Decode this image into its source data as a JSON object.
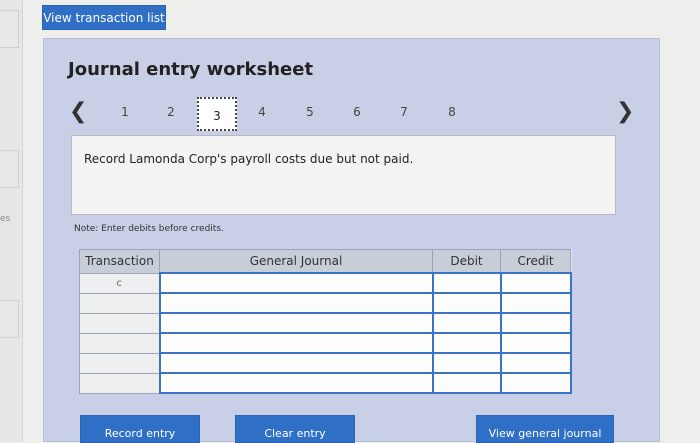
{
  "header": {
    "view_list_label": "View transaction list"
  },
  "sidebar_fragment": {
    "text": "es"
  },
  "worksheet": {
    "title": "Journal entry worksheet",
    "pager": {
      "prev_icon": "chevron-left-icon",
      "next_icon": "chevron-right-icon",
      "pages": [
        "1",
        "2",
        "3",
        "4",
        "5",
        "6",
        "7",
        "8"
      ],
      "current": "3"
    },
    "instruction": "Record Lamonda Corp's payroll costs due but not paid.",
    "note": "Note: Enter debits before credits.",
    "table": {
      "headers": [
        "Transaction",
        "General Journal",
        "Debit",
        "Credit"
      ],
      "rows": [
        {
          "transaction": "c",
          "account": "",
          "debit": "",
          "credit": ""
        },
        {
          "transaction": "",
          "account": "",
          "debit": "",
          "credit": ""
        },
        {
          "transaction": "",
          "account": "",
          "debit": "",
          "credit": ""
        },
        {
          "transaction": "",
          "account": "",
          "debit": "",
          "credit": ""
        },
        {
          "transaction": "",
          "account": "",
          "debit": "",
          "credit": ""
        },
        {
          "transaction": "",
          "account": "",
          "debit": "",
          "credit": ""
        }
      ]
    },
    "buttons": {
      "record": "Record entry",
      "clear": "Clear entry",
      "view_general": "View general journal"
    }
  },
  "colors": {
    "accent": "#2f6fc6",
    "panel": "#c9cfe6",
    "input_border": "#3a73c8"
  }
}
